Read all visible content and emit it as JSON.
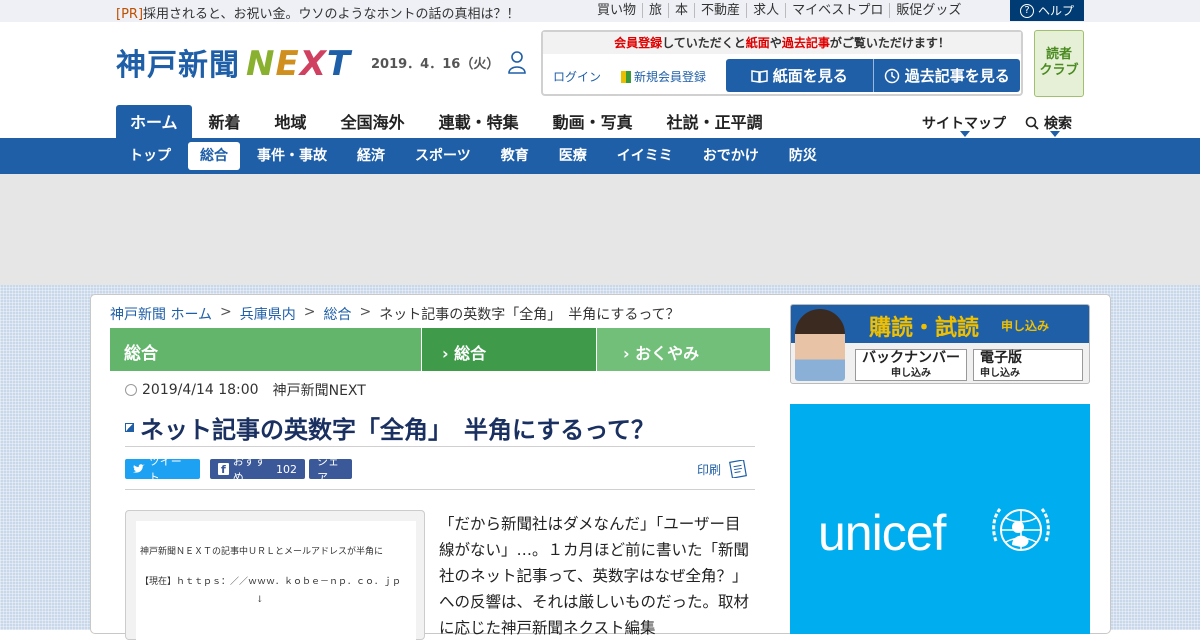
{
  "topbar": {
    "pr_tag": "[PR]",
    "pr_text": "採用されると、お祝い金。ウソのようなホントの話の真相は？！",
    "links": [
      "買い物",
      "旅",
      "本",
      "不動産",
      "求人",
      "マイベストプロ",
      "販促グッズ"
    ],
    "help_label": "ヘルプ"
  },
  "header": {
    "logo_jp": "神戸新聞",
    "logo_next": "NEXT",
    "date": "2019．4．16（火）",
    "member_msg_parts": [
      "会員登録",
      "していただくと",
      "紙面",
      "や",
      "過去記事",
      "がご覧いただけます！"
    ],
    "login": "ログイン",
    "register": "新規会員登録",
    "btn_paper": "紙面を見る",
    "btn_archive": "過去記事を見る",
    "reader_club_1": "読者",
    "reader_club_2": "クラブ"
  },
  "nav": {
    "items": [
      "ホーム",
      "新着",
      "地域",
      "全国海外",
      "連載・特集",
      "動画・写真",
      "社説・正平調"
    ],
    "sitemap": "サイトマップ",
    "search": "検索"
  },
  "subnav": {
    "items": [
      "トップ",
      "総合",
      "事件・事故",
      "経済",
      "スポーツ",
      "教育",
      "医療",
      "イイミミ",
      "おでかけ",
      "防災"
    ]
  },
  "breadcrumb": [
    "神戸新聞 ホーム",
    "兵庫県内",
    "総合",
    "ネット記事の英数字「全角」　半角にするって？"
  ],
  "category_bar": {
    "current": "総合",
    "tab1": "総合",
    "tab2": "おくやみ"
  },
  "article": {
    "datetime": "2019/4/14 18:00",
    "source": "神戸新聞NEXT",
    "title": "ネット記事の英数字「全角」　半角にするって？",
    "tweet": "ツイート",
    "fb_recommend": "おすすめ",
    "fb_count": "102",
    "share": "シェア",
    "print": "印刷",
    "image_lines": [
      "神戸新聞ＮＥＸＴの記事中ＵＲＬとメールアドレスが半角に",
      "【現在】ｈｔｔｐｓ：／／ｗｗｗ．ｋｏｂｅ－ｎｐ．ｃｏ．ｊｐ",
      "↓"
    ],
    "body": "「だから新聞社はダメなんだ」「ユーザー目線がない」…。１カ月ほど前に書いた「新聞社のネット記事って、英数字はなぜ全角？」への反響は、それは厳しいものだった。取材に応じた神戸新聞ネクスト編集"
  },
  "sidebar": {
    "subscribe_title": "購読・試読",
    "subscribe_sub": "申し込み",
    "backnumber": "バックナンバー",
    "backnumber_sub": "申し込み",
    "digital": "電子版",
    "digital_sub": "申し込み",
    "ad_brand": "unicef"
  },
  "colors": {
    "brand_blue": "#1f5fa8",
    "category_green": "#62b56b",
    "unicef_blue": "#00aeef",
    "alert_red": "#e00000"
  }
}
